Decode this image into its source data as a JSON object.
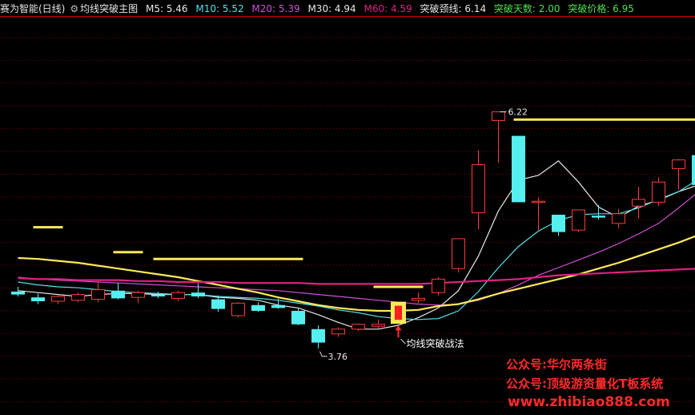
{
  "header": {
    "app_title": "赛为智能(日线)",
    "indicator_name": "均线突破主图",
    "m5": "M5: 5.46",
    "m10": "M10: 5.52",
    "m20": "M20: 5.39",
    "m30": "M30: 4.94",
    "m60": "M60: 4.59",
    "neck": "突破颈线: 6.14",
    "days": "突破天数: 2.00",
    "price": "突破价格: 6.95"
  },
  "colors": {
    "up": "#ff3a3a",
    "down": "#54f0f0",
    "m5": "#e8e8e8",
    "m10": "#54e0e8",
    "m20": "#d050d8",
    "m30": "#ffffff",
    "m60": "#e02080",
    "gold": "#ffe85a",
    "grid": "#8a0000"
  },
  "watermarks": {
    "line1": "公众号:华尔两条街",
    "line2": "公众号:顶级游资量化T板系统",
    "line3": "www.zhibiao888.com"
  },
  "chart_data": {
    "type": "candlestick",
    "title": "赛为智能(日线)",
    "indicator": "均线突破主图",
    "ylim": [
      3.3,
      7.2
    ],
    "grid": true,
    "annotations": [
      {
        "text": "6.22",
        "label": "high"
      },
      {
        "text": "3.76",
        "label": "low"
      },
      {
        "text": "均线突破战法",
        "label": "signal"
      }
    ],
    "candles": [
      {
        "o": 4.35,
        "h": 4.4,
        "l": 4.3,
        "c": 4.32
      },
      {
        "o": 4.29,
        "h": 4.33,
        "l": 4.22,
        "c": 4.25
      },
      {
        "o": 4.25,
        "h": 4.31,
        "l": 4.22,
        "c": 4.3
      },
      {
        "o": 4.26,
        "h": 4.34,
        "l": 4.24,
        "c": 4.32
      },
      {
        "o": 4.27,
        "h": 4.45,
        "l": 4.24,
        "c": 4.37
      },
      {
        "o": 4.36,
        "h": 4.44,
        "l": 4.27,
        "c": 4.28
      },
      {
        "o": 4.29,
        "h": 4.36,
        "l": 4.23,
        "c": 4.34
      },
      {
        "o": 4.32,
        "h": 4.35,
        "l": 4.28,
        "c": 4.3
      },
      {
        "o": 4.28,
        "h": 4.36,
        "l": 4.25,
        "c": 4.34
      },
      {
        "o": 4.34,
        "h": 4.44,
        "l": 4.28,
        "c": 4.3
      },
      {
        "o": 4.27,
        "h": 4.31,
        "l": 4.14,
        "c": 4.17
      },
      {
        "o": 4.1,
        "h": 4.24,
        "l": 4.08,
        "c": 4.23
      },
      {
        "o": 4.21,
        "h": 4.24,
        "l": 4.14,
        "c": 4.15
      },
      {
        "o": 4.21,
        "h": 4.28,
        "l": 4.17,
        "c": 4.18
      },
      {
        "o": 4.15,
        "h": 4.18,
        "l": 4.0,
        "c": 4.01
      },
      {
        "o": 3.96,
        "h": 4.0,
        "l": 3.76,
        "c": 3.82
      },
      {
        "o": 3.91,
        "h": 3.98,
        "l": 3.88,
        "c": 3.96
      },
      {
        "o": 3.96,
        "h": 4.02,
        "l": 3.94,
        "c": 4.01
      },
      {
        "o": 3.99,
        "h": 4.06,
        "l": 3.97,
        "c": 4.01
      },
      {
        "o": 4.06,
        "h": 4.22,
        "l": 4.04,
        "c": 4.16
      },
      {
        "o": 4.26,
        "h": 4.34,
        "l": 4.23,
        "c": 4.28
      },
      {
        "o": 4.34,
        "h": 4.5,
        "l": 4.31,
        "c": 4.48
      },
      {
        "o": 4.59,
        "h": 4.9,
        "l": 4.55,
        "c": 4.9
      },
      {
        "o": 5.17,
        "h": 5.82,
        "l": 5.0,
        "c": 5.67
      },
      {
        "o": 6.13,
        "h": 6.22,
        "l": 5.69,
        "c": 6.22
      },
      {
        "o": 5.97,
        "h": 5.97,
        "l": 5.28,
        "c": 5.28
      },
      {
        "o": 5.29,
        "h": 5.33,
        "l": 4.99,
        "c": 5.29
      },
      {
        "o": 5.15,
        "h": 5.15,
        "l": 4.93,
        "c": 4.97
      },
      {
        "o": 4.99,
        "h": 5.2,
        "l": 4.97,
        "c": 5.2
      },
      {
        "o": 5.14,
        "h": 5.25,
        "l": 5.1,
        "c": 5.12
      },
      {
        "o": 5.06,
        "h": 5.21,
        "l": 5.01,
        "c": 5.16
      },
      {
        "o": 5.24,
        "h": 5.44,
        "l": 5.11,
        "c": 5.31
      },
      {
        "o": 5.28,
        "h": 5.54,
        "l": 5.24,
        "c": 5.49
      },
      {
        "o": 5.63,
        "h": 5.73,
        "l": 5.41,
        "c": 5.72
      },
      {
        "o": 5.77,
        "h": 5.8,
        "l": 5.3,
        "c": 5.46
      }
    ],
    "lines": [
      {
        "name": "M5",
        "color_key": "m5",
        "values": [
          4.36,
          4.34,
          4.32,
          4.3,
          4.32,
          4.33,
          4.33,
          4.32,
          4.32,
          4.32,
          4.29,
          4.28,
          4.26,
          4.21,
          4.18,
          4.11,
          4.03,
          3.96,
          3.96,
          4.0,
          4.08,
          4.18,
          4.36,
          4.72,
          5.19,
          5.51,
          5.56,
          5.71,
          5.49,
          5.23,
          5.12,
          5.24,
          5.3,
          5.39,
          5.46
        ]
      },
      {
        "name": "M10",
        "color_key": "m10",
        "values": [
          4.45,
          4.42,
          4.4,
          4.39,
          4.37,
          4.35,
          4.34,
          4.33,
          4.32,
          4.32,
          4.3,
          4.29,
          4.28,
          4.26,
          4.23,
          4.2,
          4.16,
          4.13,
          4.09,
          4.07,
          4.06,
          4.07,
          4.15,
          4.35,
          4.6,
          4.82,
          4.98,
          5.09,
          5.15,
          5.16,
          5.16,
          5.22,
          5.31,
          5.39,
          5.52
        ]
      },
      {
        "name": "M20",
        "color_key": "m20",
        "values": [
          4.5,
          4.48,
          4.47,
          4.46,
          4.45,
          4.44,
          4.43,
          4.42,
          4.41,
          4.4,
          4.39,
          4.38,
          4.37,
          4.36,
          4.34,
          4.32,
          4.3,
          4.28,
          4.26,
          4.24,
          4.22,
          4.21,
          4.22,
          4.26,
          4.33,
          4.42,
          4.52,
          4.6,
          4.68,
          4.76,
          4.85,
          4.95,
          5.06,
          5.22,
          5.39
        ]
      },
      {
        "name": "M30",
        "color_key": "gold",
        "values": [
          4.7,
          4.69,
          4.67,
          4.65,
          4.62,
          4.59,
          4.56,
          4.53,
          4.5,
          4.46,
          4.42,
          4.38,
          4.34,
          4.29,
          4.25,
          4.21,
          4.18,
          4.16,
          4.15,
          4.15,
          4.16,
          4.2,
          4.22,
          4.27,
          4.33,
          4.38,
          4.43,
          4.48,
          4.53,
          4.59,
          4.65,
          4.72,
          4.79,
          4.86,
          4.94
        ]
      },
      {
        "name": "M60",
        "color_key": "m60",
        "values": [
          4.49,
          4.48,
          4.48,
          4.47,
          4.47,
          4.47,
          4.46,
          4.46,
          4.45,
          4.45,
          4.45,
          4.44,
          4.44,
          4.44,
          4.44,
          4.43,
          4.43,
          4.43,
          4.43,
          4.43,
          4.43,
          4.44,
          4.45,
          4.46,
          4.47,
          4.48,
          4.5,
          4.52,
          4.53,
          4.54,
          4.55,
          4.56,
          4.57,
          4.58,
          4.59
        ]
      }
    ],
    "gold_segments": [
      {
        "from": 1,
        "to": 2,
        "y": 5.02
      },
      {
        "from": 5,
        "to": 6,
        "y": 4.76
      },
      {
        "from": 7,
        "to": 14,
        "y": 4.69
      },
      {
        "from": 18,
        "to": 20,
        "y": 4.4
      },
      {
        "from": 25,
        "to": 34,
        "y": 6.14
      }
    ],
    "signal_candle_index": 19
  }
}
